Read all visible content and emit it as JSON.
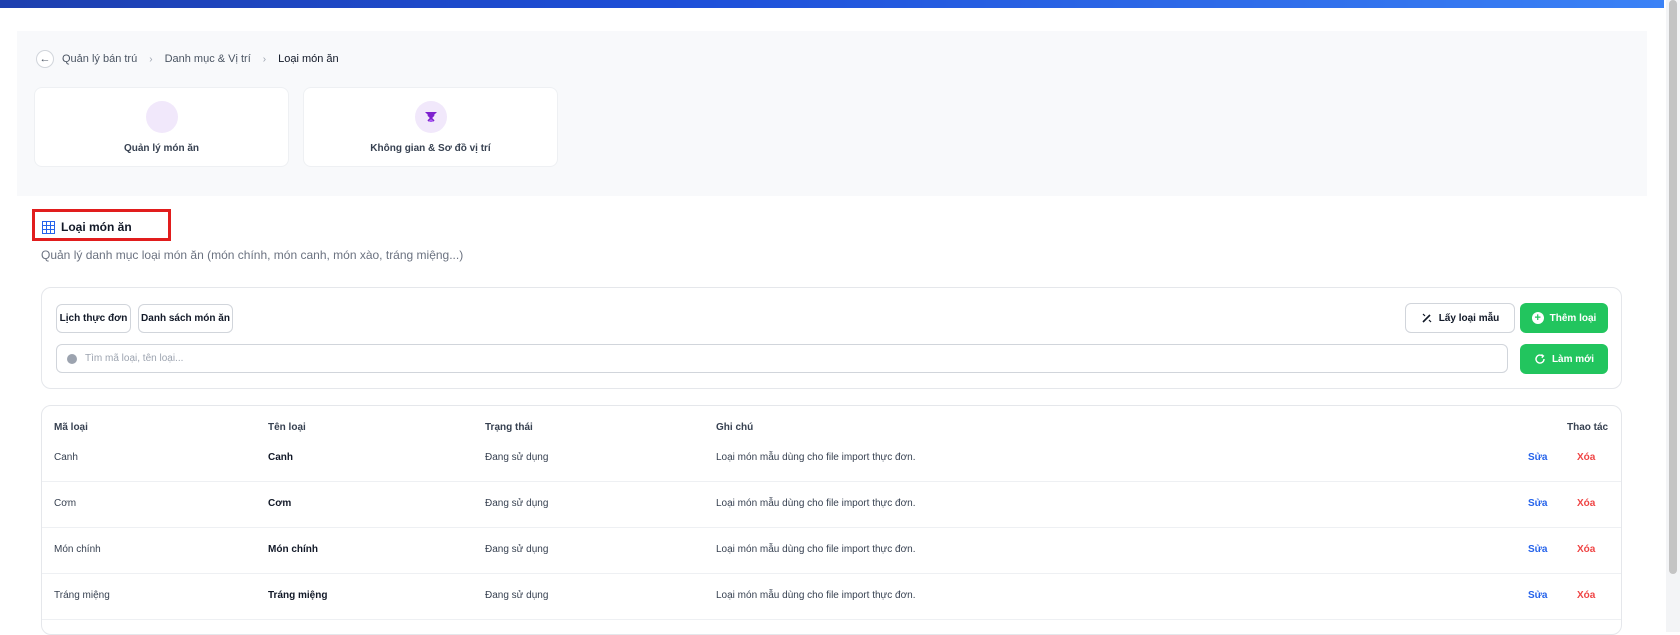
{
  "breadcrumb": {
    "items": [
      "Quản lý bán trú",
      "Danh mục & Vị trí"
    ],
    "current": "Loại món ăn"
  },
  "cards": [
    {
      "label": "Quản lý món ăn",
      "icon": "dish-icon"
    },
    {
      "label": "Không gian & Sơ đồ vị trí",
      "icon": "location-map-icon"
    }
  ],
  "section": {
    "title": "Loại món ăn",
    "icon": "grid-table-icon",
    "subtitle": "Quản lý danh mục loại món ăn (món chính, món canh, món xào, tráng miệng...)"
  },
  "toolbar": {
    "tabs": [
      "Lịch thực đơn",
      "Danh sách món ăn"
    ],
    "sample_label": "Lấy loại mẫu",
    "add_label": "Thêm loại",
    "refresh_label": "Làm mới",
    "search_placeholder": "Tìm mã loại, tên loại..."
  },
  "table": {
    "headers": {
      "code": "Mã loại",
      "name": "Tên loại",
      "status": "Trạng thái",
      "note": "Ghi chú",
      "actions": "Thao tác"
    },
    "rows": [
      {
        "code": "Canh",
        "name": "Canh",
        "status": "Đang sử dụng",
        "note": "Loại món mẫu dùng cho file import thực đơn.",
        "edit": "Sửa",
        "delete": "Xóa"
      },
      {
        "code": "Cơm",
        "name": "Cơm",
        "status": "Đang sử dụng",
        "note": "Loại món mẫu dùng cho file import thực đơn.",
        "edit": "Sửa",
        "delete": "Xóa"
      },
      {
        "code": "Món chính",
        "name": "Món chính",
        "status": "Đang sử dụng",
        "note": "Loại món mẫu dùng cho file import thực đơn.",
        "edit": "Sửa",
        "delete": "Xóa"
      },
      {
        "code": "Tráng miệng",
        "name": "Tráng miệng",
        "status": "Đang sử dụng",
        "note": "Loại món mẫu dùng cho file import thực đơn.",
        "edit": "Sửa",
        "delete": "Xóa"
      }
    ]
  },
  "colors": {
    "accent_green": "#22c55e",
    "header_blue": "#1d4ed8",
    "edit_blue": "#2563eb",
    "delete_red": "#ef4444",
    "highlight_red": "#e11d1d"
  }
}
